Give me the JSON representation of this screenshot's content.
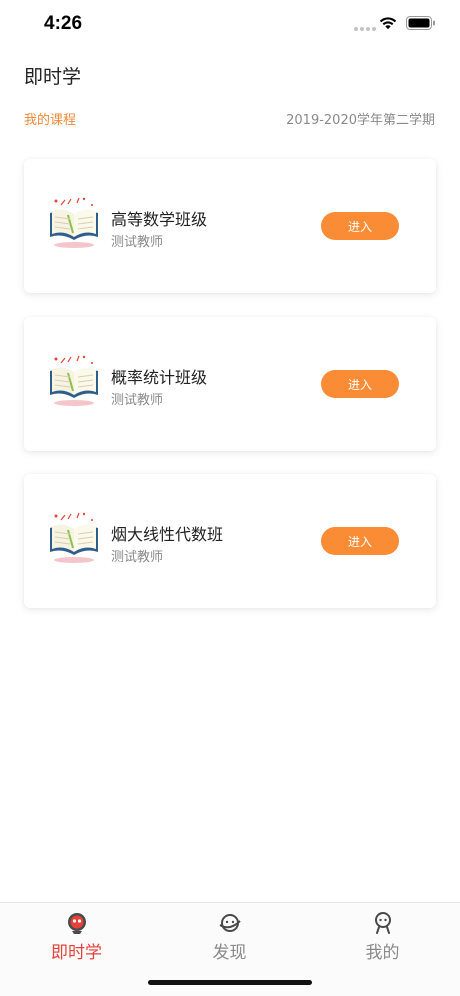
{
  "status_bar": {
    "time": "4:26"
  },
  "header": {
    "title": "即时学",
    "section_label": "我的课程",
    "semester": "2019-2020学年第二学期"
  },
  "courses": [
    {
      "name": "高等数学班级",
      "teacher": "测试教师",
      "enter_label": "进入",
      "icon": "open-book-icon"
    },
    {
      "name": "概率统计班级",
      "teacher": "测试教师",
      "enter_label": "进入",
      "icon": "open-book-icon"
    },
    {
      "name": "烟大线性代数班",
      "teacher": "测试教师",
      "enter_label": "进入",
      "icon": "open-book-icon"
    }
  ],
  "tab_bar": {
    "tabs": [
      {
        "label": "即时学",
        "icon": "mascot-icon",
        "active": true
      },
      {
        "label": "发现",
        "icon": "planet-icon",
        "active": false
      },
      {
        "label": "我的",
        "icon": "person-icon",
        "active": false
      }
    ]
  },
  "colors": {
    "accent": "#fb8c36",
    "section_label": "#f08a3c",
    "active_tab": "#e5433a",
    "muted_text": "#8a8a8a"
  }
}
